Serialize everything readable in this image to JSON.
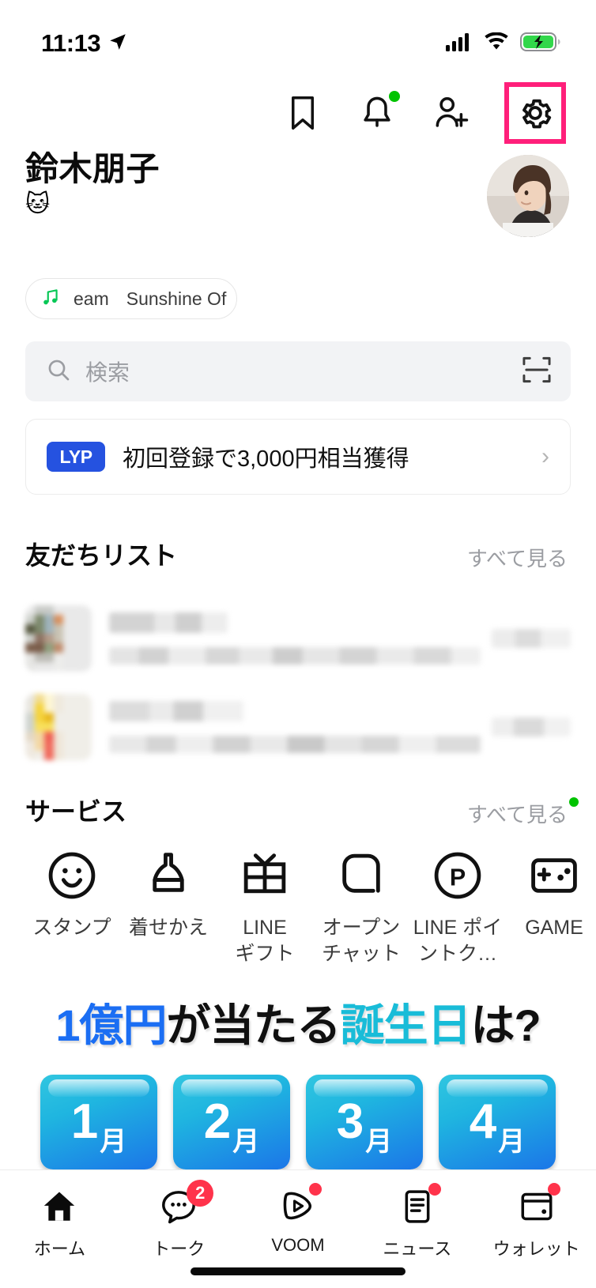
{
  "status_bar": {
    "time": "11:13",
    "location_icon": "location-arrow-icon",
    "signal_icon": "cellular-signal-icon",
    "wifi_icon": "wifi-icon",
    "battery_icon": "battery-charging-icon",
    "battery_color": "#32d74b"
  },
  "header": {
    "icons": [
      {
        "name": "bookmark-icon",
        "label": "Keep"
      },
      {
        "name": "bell-icon",
        "label": "お知らせ",
        "badge": true
      },
      {
        "name": "add-friend-icon",
        "label": "友だち追加"
      },
      {
        "name": "gear-icon",
        "label": "設定",
        "highlighted": true
      }
    ],
    "highlight_color": "#ff1f7a"
  },
  "profile": {
    "name": "鈴木朋子",
    "status_emoji": "🐱",
    "avatar_alt": "プロフィール画像",
    "music": {
      "note_icon": "music-note-icon",
      "artist": "eam",
      "title": "Sunshine Of ",
      "chevron": "›"
    }
  },
  "search": {
    "icon": "search-icon",
    "placeholder": "検索",
    "scan_icon": "qr-scan-icon"
  },
  "lyp_banner": {
    "logo_text": "LYP",
    "text": "初回登録で3,000円相当獲得",
    "chevron": "›"
  },
  "friends_section": {
    "title": "友だちリスト",
    "see_all": "すべて見る",
    "rows": [
      {
        "name": "redacted",
        "subtitle": "redacted",
        "right": "redacted"
      },
      {
        "name": "redacted",
        "subtitle": "redacted",
        "right": "redacted"
      }
    ]
  },
  "services_section": {
    "title": "サービス",
    "see_all": "すべて見る",
    "see_all_badge": true,
    "items": [
      {
        "icon": "smiley-sticker-icon",
        "label": "スタンプ"
      },
      {
        "icon": "brush-theme-icon",
        "label": "着せかえ"
      },
      {
        "icon": "gift-icon",
        "label": "LINE\nギフト"
      },
      {
        "icon": "openchat-bubble-icon",
        "label": "オープン\nチャット"
      },
      {
        "icon": "point-p-circle-icon",
        "label": "LINE ポイ\nントク…"
      },
      {
        "icon": "gamepad-icon",
        "label": "GAME"
      }
    ]
  },
  "ad_banner": {
    "title_parts": [
      {
        "text": "1億円",
        "color": "#1b6ef3"
      },
      {
        "text": "が当たる",
        "color": "#101010"
      },
      {
        "text": "誕生日",
        "color": "#19bcd8"
      },
      {
        "text": "は?",
        "color": "#101010"
      }
    ],
    "month_tiles": [
      {
        "number": "1",
        "suffix": "月"
      },
      {
        "number": "2",
        "suffix": "月"
      },
      {
        "number": "3",
        "suffix": "月"
      },
      {
        "number": "4",
        "suffix": "月"
      }
    ]
  },
  "bottom_nav": {
    "items": [
      {
        "icon": "home-icon",
        "label": "ホーム",
        "active": true,
        "badge": null,
        "dot": false
      },
      {
        "icon": "chat-bubble-icon",
        "label": "トーク",
        "active": false,
        "badge": "2",
        "dot": false
      },
      {
        "icon": "voom-play-icon",
        "label": "VOOM",
        "active": false,
        "badge": null,
        "dot": true
      },
      {
        "icon": "news-doc-icon",
        "label": "ニュース",
        "active": false,
        "badge": null,
        "dot": true
      },
      {
        "icon": "wallet-icon",
        "label": "ウォレット",
        "active": false,
        "badge": null,
        "dot": true
      }
    ],
    "badge_color": "#ff334b"
  }
}
